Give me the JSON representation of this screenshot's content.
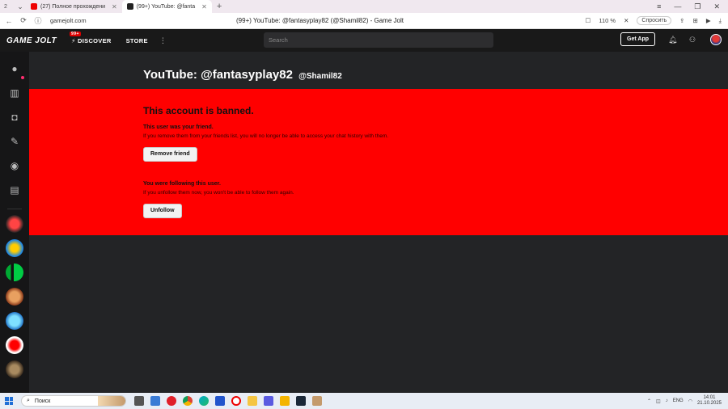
{
  "browser": {
    "tabs": [
      {
        "label": "(27) Полное прохождени",
        "active": false
      },
      {
        "label": "(99+) YouTube: @fanta",
        "active": true
      }
    ],
    "tab_count": "2",
    "url": "gamejolt.com",
    "page_title": "(99+) YouTube: @fantasyplay82 (@Shamil82) - Game Jolt",
    "zoom": "110 %",
    "ask_label": "Спросить"
  },
  "header": {
    "logo_text": "GAME JOLT",
    "logo_badge": "99+",
    "discover_label": "DISCOVER",
    "store_label": "STORE",
    "search_placeholder": "Search",
    "get_app_label": "Get App"
  },
  "profile": {
    "display_name": "YouTube: @fantasyplay82",
    "handle": "@Shamil82"
  },
  "banned": {
    "title": "This account is banned.",
    "friend_heading": "This user was your friend.",
    "friend_desc": "If you remove them from your friends list, you will no longer be able to access your chat history with them.",
    "remove_friend_label": "Remove friend",
    "follow_heading": "You were following this user.",
    "follow_desc": "If you unfollow them now, you won't be able to follow them again.",
    "unfollow_label": "Unfollow"
  },
  "taskbar": {
    "search_label": "Поиск",
    "lang": "ENG",
    "time": "14:01",
    "date": "21.10.2025"
  },
  "colors": {
    "banned_bg": "#ff0000",
    "header_bg": "#191919",
    "page_bg": "#232426"
  }
}
